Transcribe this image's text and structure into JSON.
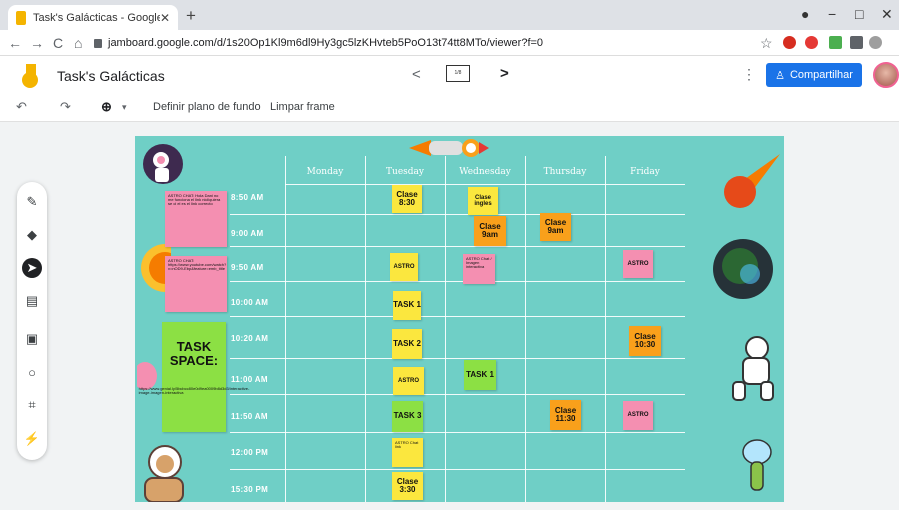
{
  "browser": {
    "tab_title": "Task's Galácticas - Google Jambo",
    "tab_close": "✕",
    "new_tab": "+",
    "url": "jamboard.google.com/d/1s20Op1Kl9m6dl9Hy3gc5lzKHvteb5PoO13t74tt8MTo/viewer?f=0",
    "back": "←",
    "forward": "→",
    "reload": "C",
    "home": "⌂",
    "minimize": "−",
    "maximize": "□",
    "close": "✕",
    "star": "☆"
  },
  "app": {
    "title": "Task's Galácticas",
    "frame_indicator": "1/8",
    "prev": "<",
    "next": ">",
    "menu": "⋮",
    "share_label": "Compartilhar"
  },
  "toolbar": {
    "undo": "↶",
    "redo": "↷",
    "zoom": "⊕",
    "zoom_caret": "▾",
    "set_background": "Definir plano de fundo",
    "clear_frame": "Limpar frame"
  },
  "tools": [
    {
      "name": "pen-tool",
      "icon": "✎"
    },
    {
      "name": "eraser-tool",
      "icon": "◆"
    },
    {
      "name": "select-tool",
      "icon": "➤"
    },
    {
      "name": "sticky-note-tool",
      "icon": "▤"
    },
    {
      "name": "image-tool",
      "icon": "▣"
    },
    {
      "name": "shape-tool",
      "icon": "○"
    },
    {
      "name": "text-box-tool",
      "icon": "⌗"
    },
    {
      "name": "laser-tool",
      "icon": "⚡"
    }
  ],
  "schedule": {
    "days": [
      "Monday",
      "Tuesday",
      "Wednesday",
      "Thursday",
      "Friday"
    ],
    "times": [
      "8:50 AM",
      "9:00 AM",
      "9:50 AM",
      "10:00 AM",
      "10:20 AM",
      "11:00 AM",
      "11:50 AM",
      "12:00 PM",
      "15:30 PM"
    ]
  },
  "notes": {
    "astro_chat_1": "ASTRO CHAT: Hola Dani no me funciona el link nicliquiera se ci el es el link correcto",
    "astro_chat_2": "ASTRO CHAT: https://www.youtube.com/watch?v=nOD9-Ebp&feature=emb_title",
    "task_space_title": "TASK SPACE:",
    "task_space_link": "https://www.genial.ly/5bcbcc80e0d9ea0009b8d3d3/interactive-image-imagen-interactiva",
    "tue_830": "Clase 8:30",
    "wed_ingles": "Clase ingles",
    "wed_9am": "Clase 9am",
    "thu_9am": "Clase 9am",
    "tue_astro_1": "ASTRO",
    "wed_small": "ASTRO Chat / Imagen interactiva",
    "fri_astro_1": "ASTRO",
    "tue_task_1": "TASK 1",
    "tue_task_2": "TASK 2",
    "fri_1030": "Clase 10:30",
    "wed_task_1": "TASK 1",
    "tue_astro_2": "ASTRO",
    "tue_task_3": "TASK 3",
    "thu_1130": "Clase 11:30",
    "fri_astro_2": "ASTRO",
    "tue_small_note": "ASTRO Chat link",
    "tue_330": "Clase 3:30"
  },
  "colors": {
    "board_bg": "#6fcfc6",
    "share_button": "#1a73e8",
    "note_yellow": "#fbe73e",
    "note_orange": "#f9a01b",
    "note_pink": "#f48fb1",
    "note_green": "#8ce044"
  }
}
